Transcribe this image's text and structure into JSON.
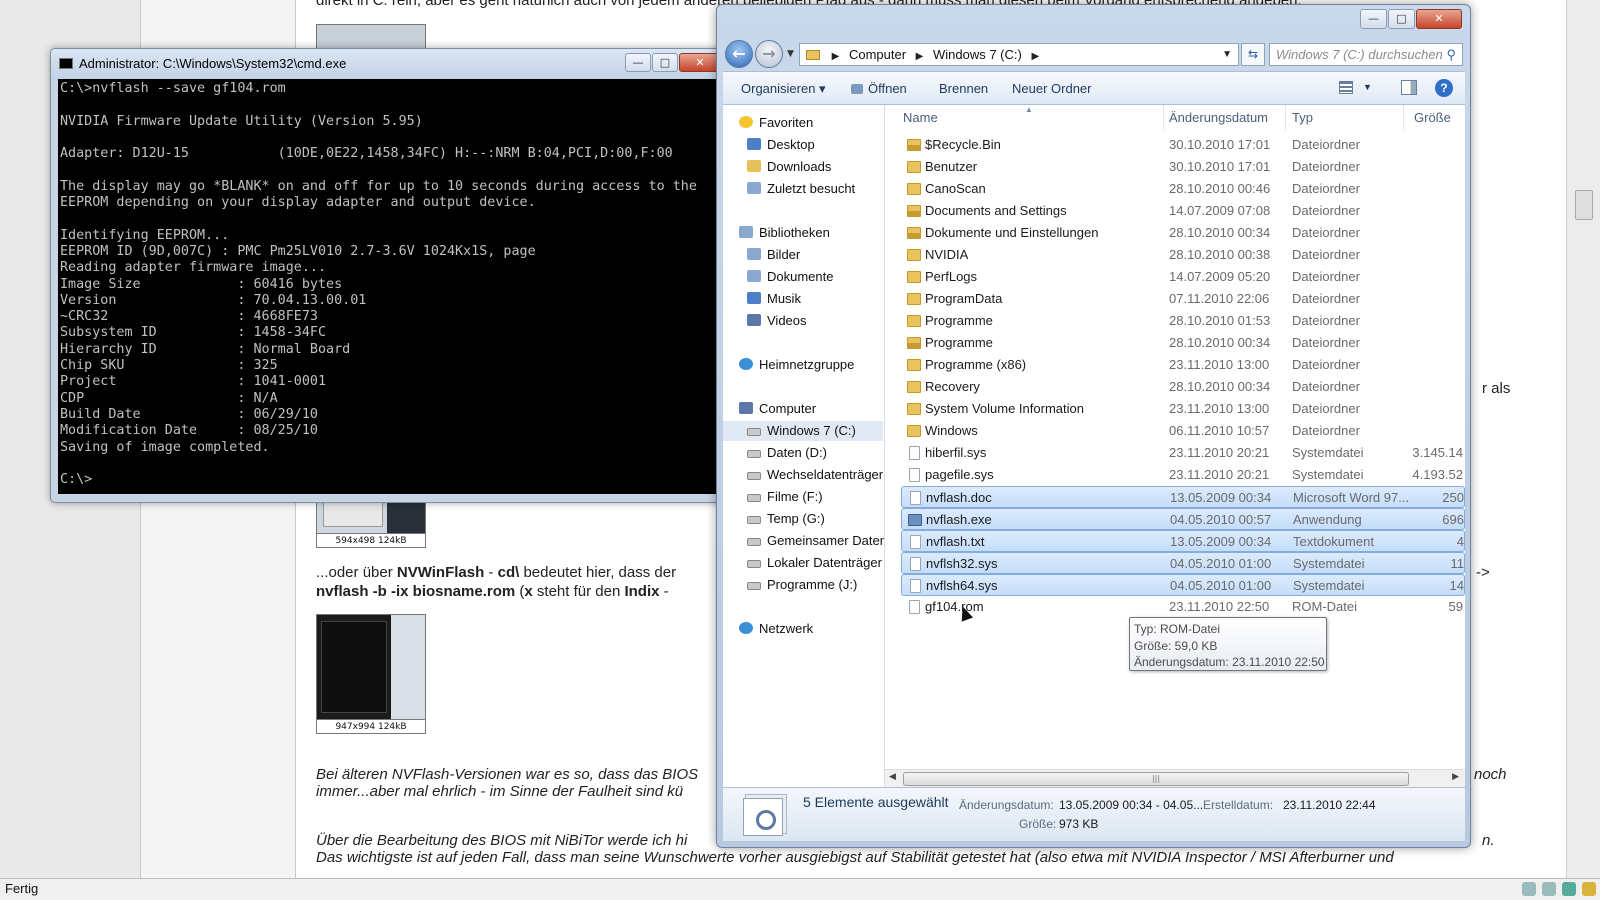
{
  "background": {
    "top_line": "direkt in C: rein, aber es geht natürlich auch von jedem anderen beliebigen Pfad aus - dann muss man diesen beim Vorgang entsprechend angeben.",
    "thumb1_caption": "594x498 124kB",
    "thumb2_caption": "947x994 124kB",
    "line_or_pre": "...oder über ",
    "line_or_bold1": "NVWinFlash",
    "line_or_mid": " - ",
    "line_or_bold2": "cd\\",
    "line_or_post": " bedeutet hier, dass der",
    "line_cmd_bold1": "nvflash -b -ix biosname.rom",
    "line_cmd_mid": " (",
    "line_cmd_bold2": "x",
    "line_cmd_mid2": " steht für den ",
    "line_cmd_bold3": "Indix",
    "line_cmd_post": " -",
    "right_fragment1": "r als",
    "right_fragment2": "->",
    "italic1a": "Bei älteren NVFlash-Versionen war es so, dass das BIOS",
    "italic1b": "immer...aber mal ehrlich - im Sinne der Faulheit sind kü",
    "italic1_right": "noch",
    "italic2a": "Über die Bearbeitung des BIOS mit NiBiTor werde ich hi",
    "italic2_right": "n.",
    "italic2b": "Das wichtigste ist auf jeden Fall, dass man seine Wunschwerte vorher ausgiebigst auf Stabilität getestet hat (also etwa mit NVIDIA Inspector / MSI Afterburner und"
  },
  "statusbar": {
    "text": "Fertig"
  },
  "cmd": {
    "title": "Administrator: C:\\Windows\\System32\\cmd.exe",
    "lines": [
      "C:\\>nvflash --save gf104.rom",
      "",
      "NVIDIA Firmware Update Utility (Version 5.95)",
      "",
      "Adapter: D12U-15           (10DE,0E22,1458,34FC) H:--:NRM B:04,PCI,D:00,F:00",
      "",
      "The display may go *BLANK* on and off for up to 10 seconds during access to the",
      "EEPROM depending on your display adapter and output device.",
      "",
      "Identifying EEPROM...",
      "EEPROM ID (9D,007C) : PMC Pm25LV010 2.7-3.6V 1024Kx1S, page",
      "Reading adapter firmware image...",
      "Image Size            : 60416 bytes",
      "Version               : 70.04.13.00.01",
      "~CRC32                : 4668FE73",
      "Subsystem ID          : 1458-34FC",
      "Hierarchy ID          : Normal Board",
      "Chip SKU              : 325",
      "Project               : 1041-0001",
      "CDP                   : N/A",
      "Build Date            : 06/29/10",
      "Modification Date     : 08/25/10",
      "Saving of image completed.",
      "",
      "C:\\>"
    ]
  },
  "explorer": {
    "address": {
      "seg1": "Computer",
      "seg2": "Windows 7 (C:)"
    },
    "search_placeholder": "Windows 7 (C:) durchsuchen",
    "toolbar": {
      "organize": "Organisieren",
      "open": "Öffnen",
      "burn": "Brennen",
      "new_folder": "Neuer Ordner"
    },
    "nav": {
      "favorites": "Favoriten",
      "desktop": "Desktop",
      "downloads": "Downloads",
      "recent": "Zuletzt besucht",
      "libraries": "Bibliotheken",
      "pictures": "Bilder",
      "documents": "Dokumente",
      "music": "Musik",
      "videos": "Videos",
      "homegroup": "Heimnetzgruppe",
      "computer": "Computer",
      "drive_c": "Windows 7 (C:)",
      "drive_d": "Daten (D:)",
      "removable": "Wechseldatenträger",
      "drive_f": "Filme (F:)",
      "drive_g": "Temp (G:)",
      "shared": "Gemeinsamer Daten",
      "local": "Lokaler Datenträger",
      "drive_j": "Programme (J:)",
      "network": "Netzwerk"
    },
    "columns": {
      "name": "Name",
      "date": "Änderungsdatum",
      "type": "Typ",
      "size": "Größe"
    },
    "files": [
      {
        "name": "$Recycle.Bin",
        "date": "30.10.2010 17:01",
        "type": "Dateiordner",
        "size": ""
      },
      {
        "name": "Benutzer",
        "date": "30.10.2010 17:01",
        "type": "Dateiordner",
        "size": ""
      },
      {
        "name": "CanoScan",
        "date": "28.10.2010 00:46",
        "type": "Dateiordner",
        "size": ""
      },
      {
        "name": "Documents and Settings",
        "date": "14.07.2009 07:08",
        "type": "Dateiordner",
        "size": ""
      },
      {
        "name": "Dokumente und Einstellungen",
        "date": "28.10.2010 00:34",
        "type": "Dateiordner",
        "size": ""
      },
      {
        "name": "NVIDIA",
        "date": "28.10.2010 00:38",
        "type": "Dateiordner",
        "size": ""
      },
      {
        "name": "PerfLogs",
        "date": "14.07.2009 05:20",
        "type": "Dateiordner",
        "size": ""
      },
      {
        "name": "ProgramData",
        "date": "07.11.2010 22:06",
        "type": "Dateiordner",
        "size": ""
      },
      {
        "name": "Programme",
        "date": "28.10.2010 01:53",
        "type": "Dateiordner",
        "size": ""
      },
      {
        "name": "Programme",
        "date": "28.10.2010 00:34",
        "type": "Dateiordner",
        "size": ""
      },
      {
        "name": "Programme (x86)",
        "date": "23.11.2010 13:00",
        "type": "Dateiordner",
        "size": ""
      },
      {
        "name": "Recovery",
        "date": "28.10.2010 00:34",
        "type": "Dateiordner",
        "size": ""
      },
      {
        "name": "System Volume Information",
        "date": "23.11.2010 13:00",
        "type": "Dateiordner",
        "size": ""
      },
      {
        "name": "Windows",
        "date": "06.11.2010 10:57",
        "type": "Dateiordner",
        "size": ""
      },
      {
        "name": "hiberfil.sys",
        "date": "23.11.2010 20:21",
        "type": "Systemdatei",
        "size": "3.145.14"
      },
      {
        "name": "pagefile.sys",
        "date": "23.11.2010 20:21",
        "type": "Systemdatei",
        "size": "4.193.52"
      },
      {
        "name": "nvflash.doc",
        "date": "13.05.2009 00:34",
        "type": "Microsoft Word 97...",
        "size": "250"
      },
      {
        "name": "nvflash.exe",
        "date": "04.05.2010 00:57",
        "type": "Anwendung",
        "size": "696"
      },
      {
        "name": "nvflash.txt",
        "date": "13.05.2009 00:34",
        "type": "Textdokument",
        "size": "4"
      },
      {
        "name": "nvflsh32.sys",
        "date": "04.05.2010 01:00",
        "type": "Systemdatei",
        "size": "11"
      },
      {
        "name": "nvflsh64.sys",
        "date": "04.05.2010 01:00",
        "type": "Systemdatei",
        "size": "14"
      },
      {
        "name": "gf104.rom",
        "date": "23.11.2010 22:50",
        "type": "ROM-Datei",
        "size": "59"
      }
    ],
    "tooltip": {
      "line1": "Typ: ROM-Datei",
      "line2": "Größe: 59,0 KB",
      "line3": "Änderungsdatum: 23.11.2010 22:50"
    },
    "details": {
      "count": "5 Elemente ausgewählt",
      "mod_label": "Änderungsdatum:",
      "mod_value": "13.05.2009 00:34 - 04.05...",
      "created_label": "Erstelldatum:",
      "created_value": "23.11.2010 22:44",
      "size_label": "Größe:",
      "size_value": "973 KB"
    }
  }
}
